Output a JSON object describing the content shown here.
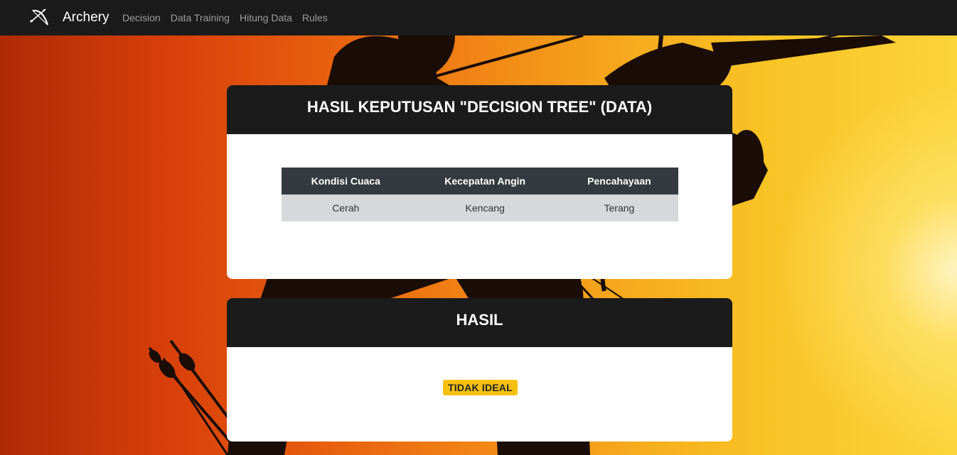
{
  "navbar": {
    "brand": "Archery",
    "links": [
      "Decision",
      "Data Training",
      "Hitung Data",
      "Rules"
    ]
  },
  "decision_card": {
    "title": "HASIL KEPUTUSAN \"DECISION TREE\" (DATA)",
    "table": {
      "headers": [
        "Kondisi Cuaca",
        "Kecepatan Angin",
        "Pencahayaan"
      ],
      "rows": [
        [
          "Cerah",
          "Kencang",
          "Terang"
        ]
      ]
    }
  },
  "result_card": {
    "title": "HASIL",
    "badge": "TIDAK IDEAL"
  },
  "colors": {
    "navbar_bg": "#1b1b1b",
    "table_header_bg": "#343a40",
    "table_row_bg": "#d6d8db",
    "badge_bg": "#f6c00e"
  },
  "icons": {
    "brand": "bow-and-arrow-icon"
  }
}
